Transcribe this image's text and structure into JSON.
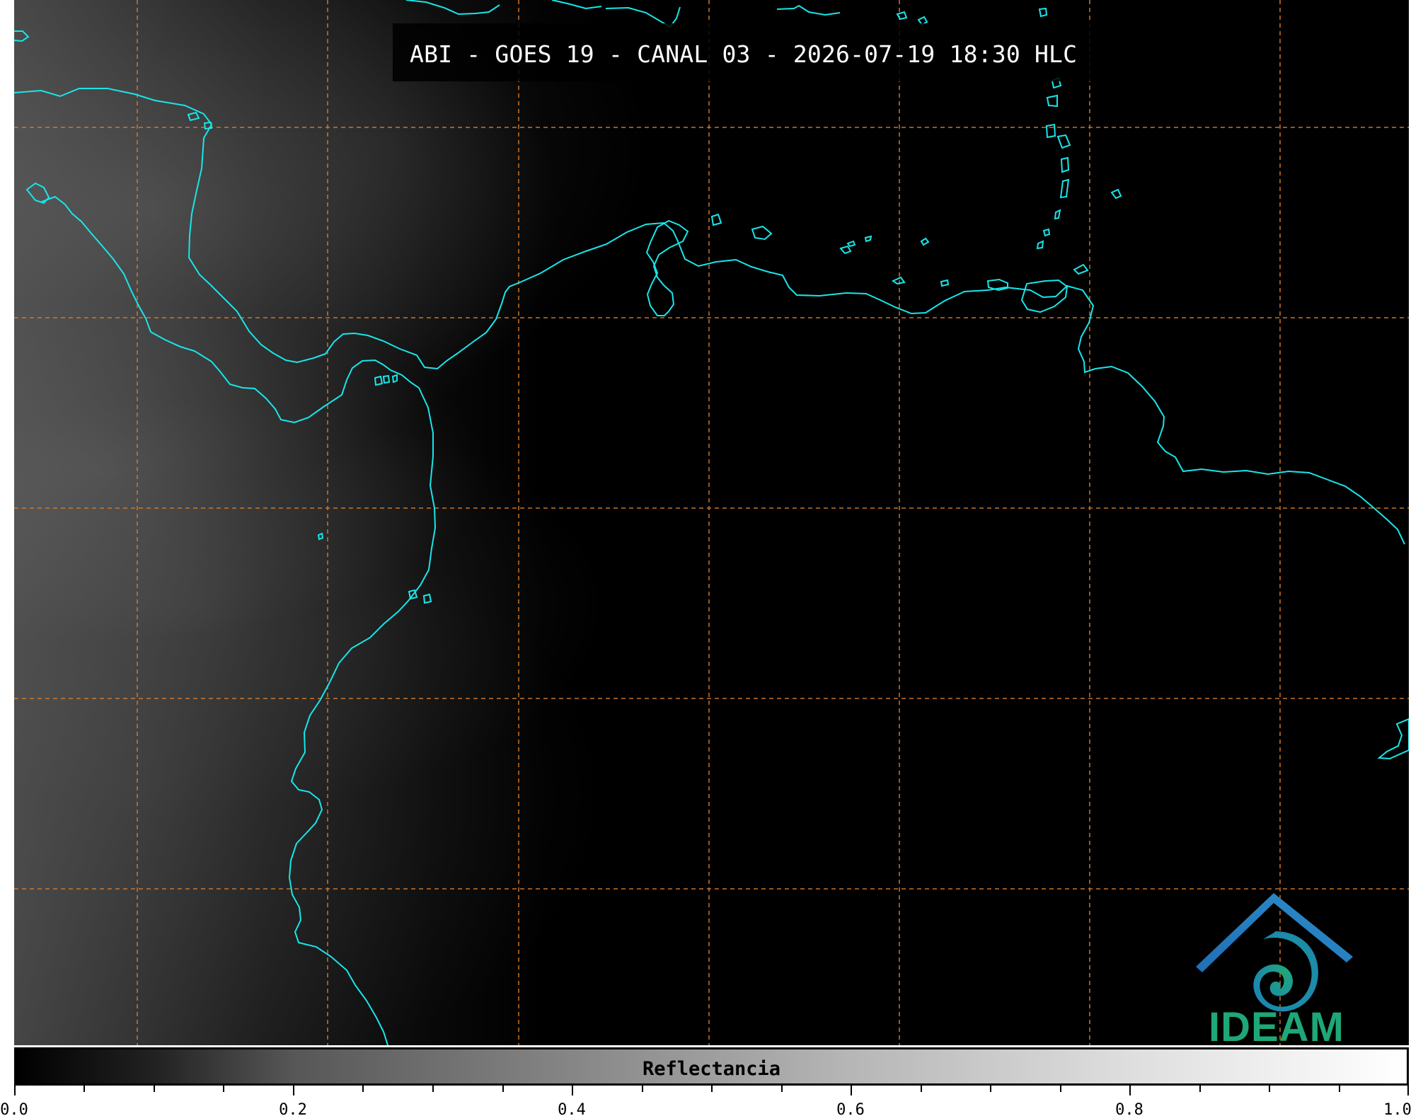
{
  "title": "ABI - GOES 19 - CANAL 03 - 2026-07-19 18:30 HLC",
  "logo": {
    "name": "IDEAM"
  },
  "colorbar": {
    "label": "Reflectancia",
    "ticks": [
      "0.0",
      "0.2",
      "0.4",
      "0.6",
      "0.8",
      "1.0"
    ]
  },
  "colors": {
    "coastline": "#18e6ea",
    "gridline": "#d67a2b",
    "logo_blue": "#1f6fb6",
    "logo_green": "#1ea777"
  }
}
